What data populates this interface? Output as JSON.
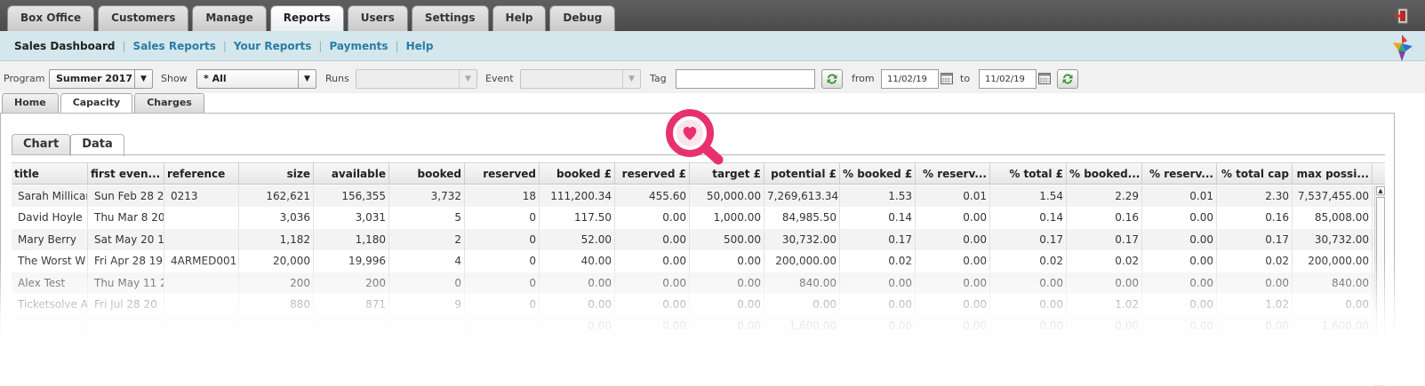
{
  "top_tabs": [
    {
      "label": "Box Office",
      "active": false
    },
    {
      "label": "Customers",
      "active": false
    },
    {
      "label": "Manage",
      "active": false
    },
    {
      "label": "Reports",
      "active": true
    },
    {
      "label": "Users",
      "active": false
    },
    {
      "label": "Settings",
      "active": false
    },
    {
      "label": "Help",
      "active": false
    },
    {
      "label": "Debug",
      "active": false
    }
  ],
  "icons": {
    "exit": "exit-door-icon",
    "logo": "app-logo-icon",
    "refresh": "refresh-icon",
    "calendar": "calendar-icon",
    "magnifier": "heart-magnifier-icon"
  },
  "sub_nav": {
    "items": [
      {
        "label": "Sales Dashboard",
        "current": true
      },
      {
        "label": "Sales Reports",
        "current": false
      },
      {
        "label": "Your Reports",
        "current": false
      },
      {
        "label": "Payments",
        "current": false
      },
      {
        "label": "Help",
        "current": false
      }
    ],
    "separator": "|"
  },
  "filters": {
    "program_label": "Program",
    "program_value": "Summer 2017",
    "show_label": "Show",
    "show_value": "* All",
    "runs_label": "Runs",
    "runs_value": "",
    "event_label": "Event",
    "event_value": "",
    "tag_label": "Tag",
    "tag_value": "",
    "from_label": "from",
    "from_value": "11/02/19",
    "to_label": "to",
    "to_value": "11/02/19"
  },
  "view_tabs": [
    {
      "label": "Home",
      "active": false
    },
    {
      "label": "Capacity",
      "active": true
    },
    {
      "label": "Charges",
      "active": false
    }
  ],
  "inner_tabs": [
    {
      "label": "Chart",
      "active": false
    },
    {
      "label": "Data",
      "active": true
    }
  ],
  "table": {
    "columns": [
      "title",
      "first even...",
      "reference",
      "size",
      "available",
      "booked",
      "reserved",
      "booked £",
      "reserved £",
      "target £",
      "potential £",
      "% booked £",
      "% reserv...",
      "% total £",
      "% booked...",
      "% reserv...",
      "% total cap",
      "max possi..."
    ],
    "rows": [
      [
        "Sarah Millican",
        "Sun Feb 28 2",
        "0213",
        "162,621",
        "156,355",
        "3,732",
        "18",
        "111,200.34",
        "455.60",
        "50,000.00",
        "7,269,613.34",
        "1.53",
        "0.01",
        "1.54",
        "2.29",
        "0.01",
        "2.30",
        "7,537,455.00"
      ],
      [
        "David Hoyle",
        "Thu Mar 8 20",
        "",
        "3,036",
        "3,031",
        "5",
        "0",
        "117.50",
        "0.00",
        "1,000.00",
        "84,985.50",
        "0.14",
        "0.00",
        "0.14",
        "0.16",
        "0.00",
        "0.16",
        "85,008.00"
      ],
      [
        "Mary Berry",
        "Sat May 20 1",
        "",
        "1,182",
        "1,180",
        "2",
        "0",
        "52.00",
        "0.00",
        "500.00",
        "30,732.00",
        "0.17",
        "0.00",
        "0.17",
        "0.17",
        "0.00",
        "0.17",
        "30,732.00"
      ],
      [
        "The Worst W",
        "Fri Apr 28 19",
        "4ARMED001",
        "20,000",
        "19,996",
        "4",
        "0",
        "40.00",
        "0.00",
        "0.00",
        "200,000.00",
        "0.02",
        "0.00",
        "0.02",
        "0.02",
        "0.00",
        "0.02",
        "200,000.00"
      ],
      [
        "Alex Test",
        "Thu May 11 2",
        "",
        "200",
        "200",
        "0",
        "0",
        "0.00",
        "0.00",
        "0.00",
        "840.00",
        "0.00",
        "0.00",
        "0.00",
        "0.00",
        "0.00",
        "0.00",
        "840.00"
      ],
      [
        "Ticketsolve A",
        "Fri Jul 28 20",
        "",
        "880",
        "871",
        "9",
        "0",
        "0.00",
        "0.00",
        "0.00",
        "0.00",
        "0.00",
        "0.00",
        "0.00",
        "1.02",
        "0.00",
        "1.02",
        "0.00"
      ],
      [
        "",
        "",
        "",
        "",
        "",
        "",
        "",
        "0.00",
        "0.00",
        "0.00",
        "1,600.00",
        "0.00",
        "0.00",
        "0.00",
        "0.00",
        "0.00",
        "0.00",
        "1,600.00"
      ]
    ]
  }
}
